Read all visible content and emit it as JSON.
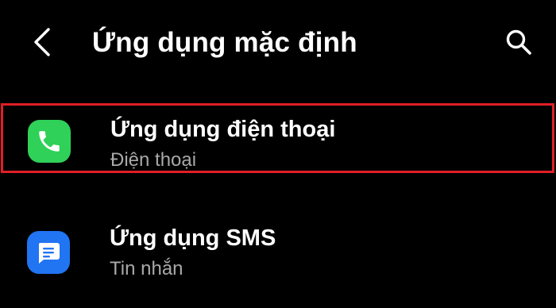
{
  "header": {
    "back_icon": "chevron-left-icon",
    "title": "Ứng dụng mặc định",
    "search_icon": "search-icon"
  },
  "items": [
    {
      "title": "Ứng dụng điện thoại",
      "subtitle": "Điện thoại",
      "icon": "phone-icon",
      "icon_color": "#2fd158",
      "highlighted": true,
      "highlight_color": "#e01e26"
    },
    {
      "title": "Ứng dụng SMS",
      "subtitle": "Tin nhắn",
      "icon": "message-icon",
      "icon_color": "#2174f2",
      "highlighted": false
    }
  ],
  "colors": {
    "background": "#000000",
    "text_primary": "#ffffff",
    "text_secondary": "#a9a9a9"
  }
}
